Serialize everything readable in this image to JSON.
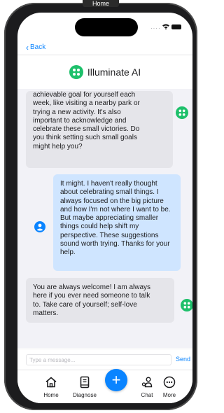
{
  "window": {
    "title": "Home"
  },
  "nav": {
    "back_label": "Back"
  },
  "header": {
    "title": "Illuminate AI"
  },
  "messages": [
    {
      "sender": "bot",
      "text": "achievable goal for yourself each\nweek, like visiting a nearby park or\ntrying a new activity. It's also\nimportant to acknowledge and\ncelebrate these small victories. Do\nyou think setting such small goals\nmight help you?"
    },
    {
      "sender": "user",
      "text": "It might. I haven't really thought\nabout celebrating small things. I\nalways focused on the big picture\nand how I'm not where I want to be.\nBut maybe appreciating smaller\nthings could help shift my\nperspective. These suggestions\nsound worth trying. Thanks for your\nhelp."
    },
    {
      "sender": "bot",
      "text": "You are always welcome! I am always\nhere if you ever need someone to talk\nto. Take care of yourself; self-love\nmatters."
    }
  ],
  "composer": {
    "placeholder": "Type a message...",
    "value": "",
    "send_label": "Send"
  },
  "tabs": [
    {
      "label": "Home",
      "icon": "home-icon"
    },
    {
      "label": "Diagnose",
      "icon": "book-icon"
    },
    {
      "label": "+",
      "icon": "plus-icon"
    },
    {
      "label": "Chat",
      "icon": "chat-people-icon"
    },
    {
      "label": "More",
      "icon": "more-icon"
    }
  ],
  "colors": {
    "accent": "#0a84ff",
    "logo": "#1ec06b",
    "user_bubble": "#cfe5ff",
    "bot_bubble": "#e5e5ea"
  }
}
